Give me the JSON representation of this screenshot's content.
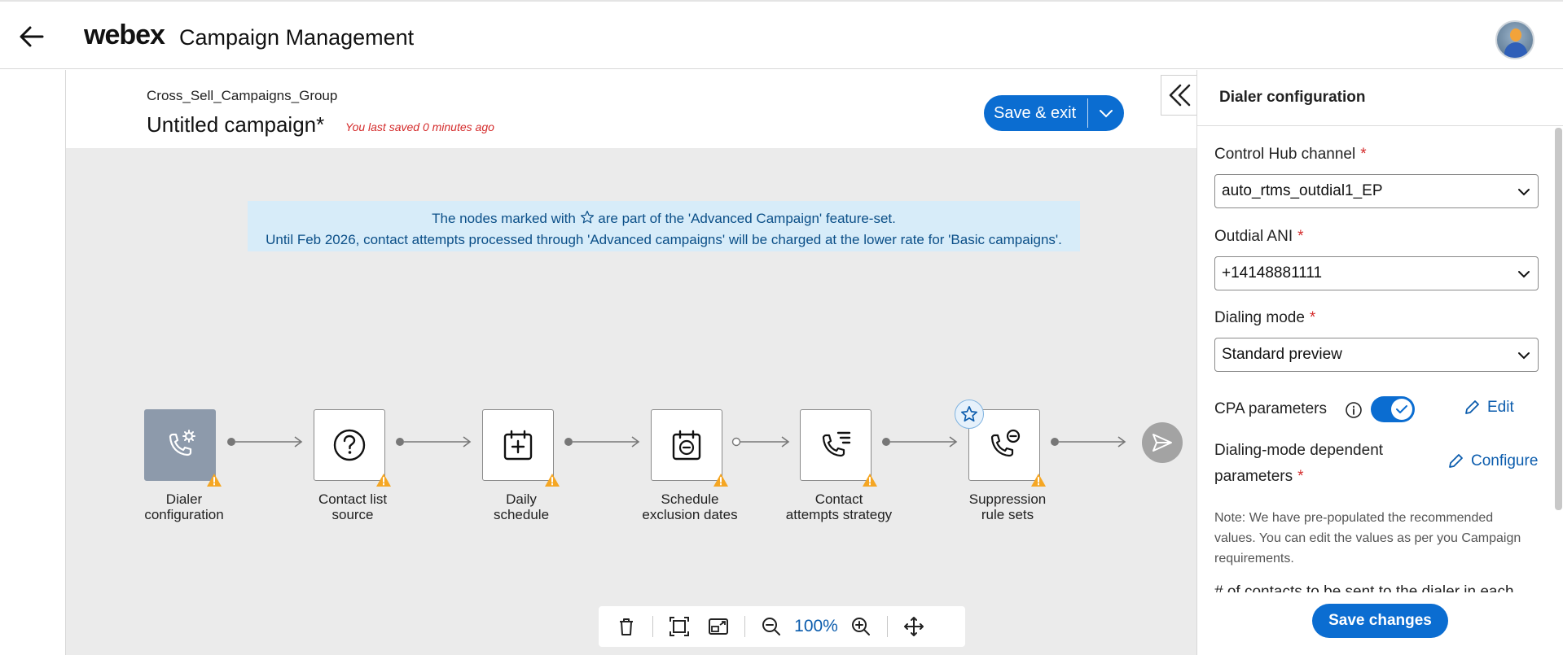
{
  "header": {
    "logo": "webex",
    "app_title": "Campaign Management"
  },
  "campaign": {
    "group": "Cross_Sell_Campaigns_Group",
    "title": "Untitled campaign*",
    "saved_note": "You last saved 0 minutes ago",
    "save_exit_label": "Save & exit"
  },
  "banner": {
    "line1_prefix": "The nodes marked with",
    "line1_suffix": "are part of the 'Advanced Campaign' feature-set.",
    "line2": "Until Feb 2026, contact attempts processed through 'Advanced campaigns' will be charged at the lower rate for 'Basic campaigns'."
  },
  "nodes": [
    {
      "label1": "Dialer",
      "label2": "configuration",
      "icon": "phone-gear-icon"
    },
    {
      "label1": "Contact list",
      "label2": "source",
      "icon": "question-circle-icon"
    },
    {
      "label1": "Daily",
      "label2": "schedule",
      "icon": "calendar-add-icon"
    },
    {
      "label1": "Schedule",
      "label2": "exclusion dates",
      "icon": "calendar-minus-icon"
    },
    {
      "label1": "Contact",
      "label2": "attempts strategy",
      "icon": "phone-list-icon"
    },
    {
      "label1": "Suppression",
      "label2": "rule sets",
      "icon": "phone-minus-icon"
    }
  ],
  "toolbar": {
    "zoom": "100%"
  },
  "panel": {
    "title": "Dialer configuration",
    "control_hub_label": "Control Hub channel",
    "control_hub_value": "auto_rtms_outdial1_EP",
    "outdial_ani_label": "Outdial ANI",
    "outdial_ani_value": "+14148881111",
    "dialing_mode_label": "Dialing mode",
    "dialing_mode_value": "Standard preview",
    "required_mark": "*",
    "cpa_label": "CPA parameters",
    "cpa_enabled": true,
    "edit_label": "Edit",
    "dm_dependent_label": "Dialing-mode dependent parameters",
    "configure_label": "Configure",
    "note": "Note: We have pre-populated the recommended values. You can edit the values as per you Campaign requirements.",
    "cut_text": "# of contacts to be sent to the dialer in each",
    "save_changes_label": "Save changes"
  },
  "colors": {
    "accent": "#0b6dd1",
    "banner_bg": "#d7ecf9",
    "warning": "#f5a623",
    "required": "#d42a2a",
    "canvas_bg": "#ebebeb"
  }
}
